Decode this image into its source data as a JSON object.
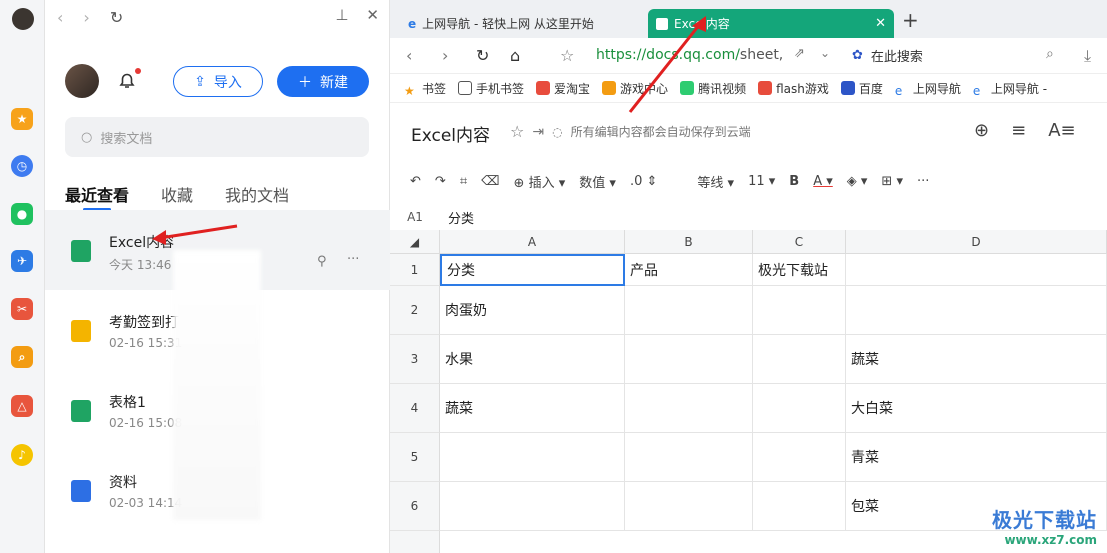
{
  "left_panel": {
    "import_label": "导入",
    "new_label": "新建",
    "search_placeholder": "搜索文档",
    "tabs": [
      "最近查看",
      "收藏",
      "我的文档"
    ],
    "docs": [
      {
        "name": "Excel内容",
        "time": "今天 13:46",
        "color": "#1fa463"
      },
      {
        "name": "考勤签到打",
        "time": "02-16 15:31",
        "color": "#f4b400"
      },
      {
        "name": "表格1",
        "time": "02-16 15:08",
        "color": "#1fa463"
      },
      {
        "name": "资料",
        "time": "02-03 14:14",
        "color": "#2d6fe4"
      }
    ]
  },
  "browser": {
    "tabs": [
      {
        "label": "上网导航 - 轻快上网 从这里开始"
      },
      {
        "label": "Excel内容"
      }
    ],
    "url_host": "https://docs.qq.com/",
    "url_path": "sheet,",
    "search_label": "在此搜索",
    "bookmarks": [
      "书签",
      "手机书签",
      "爱淘宝",
      "游戏中心",
      "腾讯视频",
      "flash游戏",
      "百度",
      "上网导航",
      "上网导航 -"
    ]
  },
  "sheet": {
    "title": "Excel内容",
    "save_note": "所有编辑内容都会自动保存到云端",
    "toolbar": {
      "insert": "插入",
      "format": "数值",
      "decimal": ".0",
      "font": "等线",
      "size": "11"
    },
    "cell_ref": "A1",
    "formula_value": "分类",
    "columns": [
      "A",
      "B",
      "C",
      "D"
    ],
    "rows": [
      {
        "num": "1",
        "cells": [
          "分类",
          "产品",
          "极光下载站",
          ""
        ]
      },
      {
        "num": "2",
        "cells": [
          "肉蛋奶",
          "",
          "",
          ""
        ]
      },
      {
        "num": "3",
        "cells": [
          "水果",
          "",
          "",
          "蔬菜"
        ]
      },
      {
        "num": "4",
        "cells": [
          "蔬菜",
          "",
          "",
          "大白菜"
        ]
      },
      {
        "num": "5",
        "cells": [
          "",
          "",
          "",
          "青菜"
        ]
      },
      {
        "num": "6",
        "cells": [
          "",
          "",
          "",
          "包菜"
        ]
      }
    ]
  },
  "watermark": {
    "cn": "极光下载站",
    "url": "www.xz7.com"
  }
}
